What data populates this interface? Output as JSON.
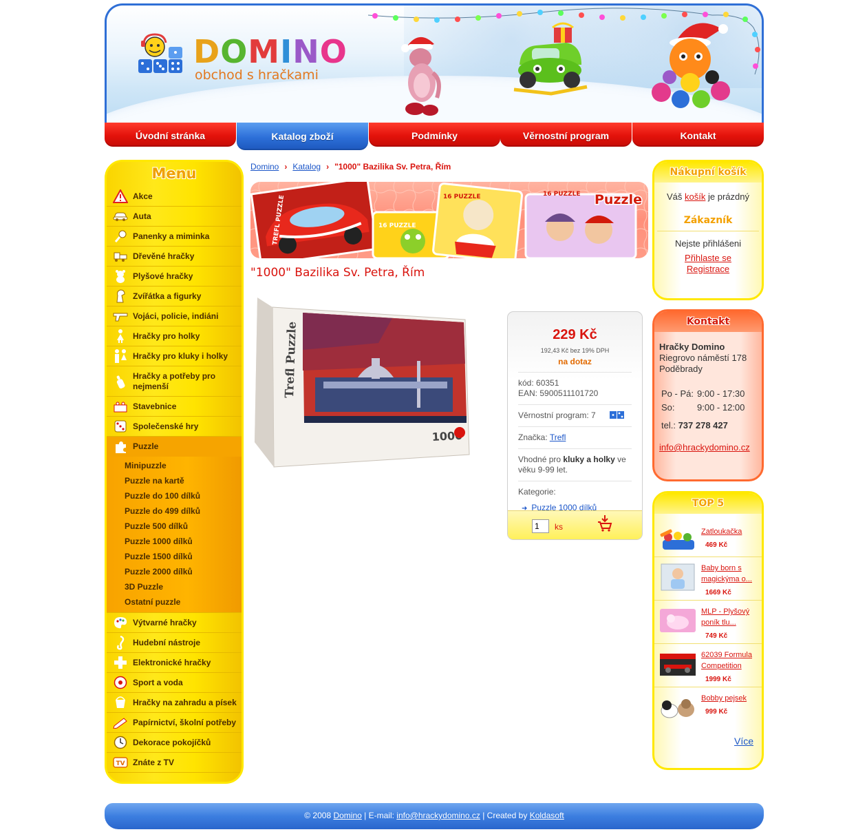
{
  "brand": {
    "name_letters": [
      "D",
      "O",
      "M",
      "I",
      "N",
      "O"
    ],
    "subtitle": "obchod s hračkami",
    "colors": {
      "red": "#e3120b",
      "blue": "#2c6fd8",
      "yellow": "#ffe800",
      "orange": "#f6a400"
    }
  },
  "nav": {
    "tabs": [
      {
        "label": "Úvodní stránka",
        "active": false
      },
      {
        "label": "Katalog zboží",
        "active": true
      },
      {
        "label": "Podmínky",
        "active": false
      },
      {
        "label": "Věrnostní program",
        "active": false
      },
      {
        "label": "Kontakt",
        "active": false
      }
    ]
  },
  "menu": {
    "title": "Menu",
    "items": [
      {
        "label": "Akce",
        "icon": "warning-icon"
      },
      {
        "label": "Auta",
        "icon": "car-icon"
      },
      {
        "label": "Panenky a miminka",
        "icon": "rattle-icon"
      },
      {
        "label": "Dřevěné hračky",
        "icon": "train-icon"
      },
      {
        "label": "Plyšové hračky",
        "icon": "teddy-icon"
      },
      {
        "label": "Zvířátka a figurky",
        "icon": "horse-icon"
      },
      {
        "label": "Vojáci, policie, indiáni",
        "icon": "gun-icon"
      },
      {
        "label": "Hračky pro holky",
        "icon": "girl-icon"
      },
      {
        "label": "Hračky pro kluky i holky",
        "icon": "kids-icon"
      },
      {
        "label": "Hračky a potřeby pro nejmenší",
        "icon": "bottle-icon"
      },
      {
        "label": "Stavebnice",
        "icon": "blocks-icon"
      },
      {
        "label": "Společenské hry",
        "icon": "dice-icon"
      },
      {
        "label": "Puzzle",
        "icon": "puzzle-icon"
      },
      {
        "label": "Výtvarné hračky",
        "icon": "palette-icon"
      },
      {
        "label": "Hudební nástroje",
        "icon": "music-icon"
      },
      {
        "label": "Elektronické hračky",
        "icon": "dpad-icon"
      },
      {
        "label": "Sport a voda",
        "icon": "ball-icon"
      },
      {
        "label": "Hračky na zahradu a písek",
        "icon": "bucket-icon"
      },
      {
        "label": "Papírnictví, školní potřeby",
        "icon": "pencil-icon"
      },
      {
        "label": "Dekorace pokojíčků",
        "icon": "clock-icon"
      },
      {
        "label": "Znáte z TV",
        "icon": "tv-icon"
      }
    ],
    "puzzle_sub": [
      "Minipuzzle",
      "Puzzle na kartě",
      "Puzzle do 100 dílků",
      "Puzzle do 499 dílků",
      "Puzzle 500 dílků",
      "Puzzle 1000 dílků",
      "Puzzle 1500 dílků",
      "Puzzle 2000 dílků",
      "3D Puzzle",
      "Ostatní puzzle"
    ]
  },
  "breadcrumb": {
    "home": "Domino",
    "catalog": "Katalog",
    "current": "\"1000\" Bazilika Sv. Petra, Řím"
  },
  "banner": {
    "badge": "Puzzle",
    "box_label": "16 PUZZLE",
    "brand_label": "TREFL PUZZLE"
  },
  "product": {
    "title": "\"1000\" Bazilika Sv. Petra, Řím",
    "box_brand": "Trefl Puzzle",
    "box_count": "1000",
    "price": "229 Kč",
    "vat_line": "192,43 Kč bez 19% DPH",
    "availability": "na dotaz",
    "code": "kód: 60351",
    "ean": "EAN: 5900511101720",
    "loyalty": "Věrnostní program: 7",
    "brand_label": "Značka: ",
    "brand_link": "Trefl",
    "suit_prefix": "Vhodné pro ",
    "suit_bold": "kluky a holky",
    "suit_mid": " ve věku 9-99 let.",
    "category_label": "Kategorie:",
    "category_link": "Puzzle 1000 dílků",
    "qty_value": "1",
    "qty_unit": "ks"
  },
  "cart": {
    "title": "Nákupní košík",
    "text_before": "Váš ",
    "link": "košík",
    "text_after": " je prázdný"
  },
  "customer": {
    "title": "Zákazník",
    "status": "Nejste přihlášeni",
    "login": "Přihlaste se",
    "register": "Registrace"
  },
  "contact": {
    "title": "Kontakt",
    "company": "Hračky Domino",
    "street": "Riegrovo náměstí 178",
    "city": "Poděbrady",
    "hours": [
      {
        "day": "Po - Pá:",
        "time": "9:00 - 17:30"
      },
      {
        "day": "So:",
        "time": "9:00 - 12:00"
      }
    ],
    "tel_label": "tel.: ",
    "tel": "737 278 427",
    "email": "info@hrackydomino.cz"
  },
  "top5": {
    "title": "TOP 5",
    "items": [
      {
        "name": "Zatloukačka",
        "price": "469 Kč"
      },
      {
        "name": "Baby born s magickýma o...",
        "price": "1669 Kč"
      },
      {
        "name": "MLP - Plyšový poník tlu...",
        "price": "749 Kč"
      },
      {
        "name": "62039 Formula Competition",
        "price": "1999 Kč"
      },
      {
        "name": "Bobby pejsek",
        "price": "999 Kč"
      }
    ],
    "more": "Více"
  },
  "footer": {
    "copy": "© 2008 ",
    "site": "Domino",
    "email_label": " | E-mail: ",
    "email": "info@hrackydomino.cz",
    "created_label": " | Created by ",
    "creator": "Koldasoft"
  }
}
